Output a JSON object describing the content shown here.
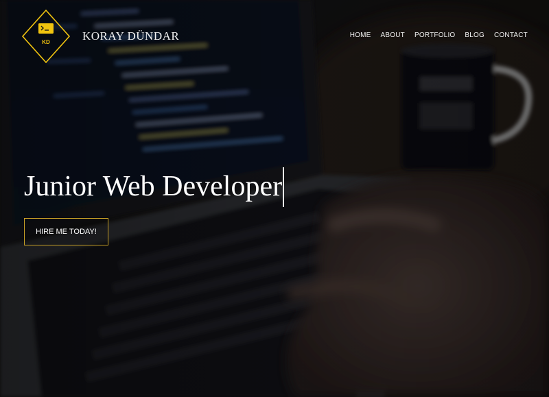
{
  "site": {
    "logo_initials": "KD",
    "brand_name": "KORAY DÜNDAR",
    "accent_color": "#f1c40f"
  },
  "nav": {
    "items": [
      "HOME",
      "ABOUT",
      "PORTFOLIO",
      "BLOG",
      "CONTACT"
    ]
  },
  "hero": {
    "headline": "Junior Web Developer",
    "cta_label": "HIRE ME TODAY!"
  }
}
